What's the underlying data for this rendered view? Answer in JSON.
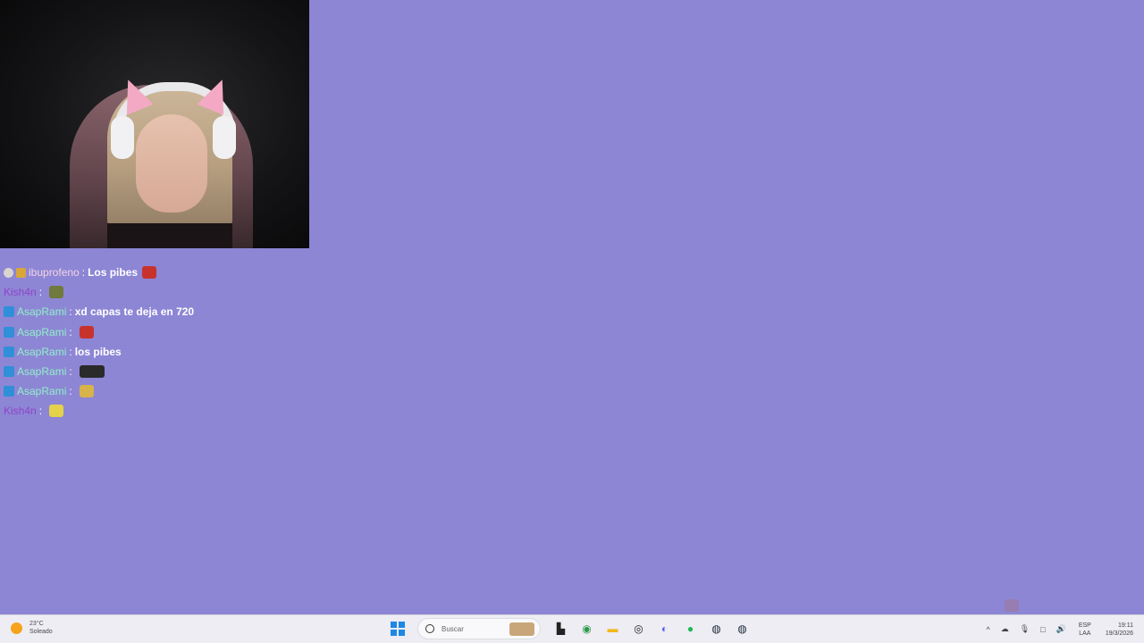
{
  "webcam": {
    "label": "webcam-feed"
  },
  "chat": {
    "messages": [
      {
        "badges": [
          "gray",
          "gold"
        ],
        "user": "ibuprofeno",
        "user_color": "#f3d3e3",
        "text": "Los pibes",
        "emote": "devil-emote",
        "emote_color": "#c8322c"
      },
      {
        "badges": [],
        "user": "Kish4n",
        "user_color": "#8e44c8",
        "text": "",
        "emote": "frog-emote",
        "emote_color": "#6f7a3c"
      },
      {
        "badges": [
          "blue"
        ],
        "user": "AsapRami",
        "user_color": "#8ff0c8",
        "text": "xd capas te deja en 720",
        "emote": "",
        "emote_color": ""
      },
      {
        "badges": [
          "blue"
        ],
        "user": "AsapRami",
        "user_color": "#8ff0c8",
        "text": "",
        "emote": "devil-emote",
        "emote_color": "#c8322c"
      },
      {
        "badges": [
          "blue"
        ],
        "user": "AsapRami",
        "user_color": "#8ff0c8",
        "text": "los pibes",
        "emote": "",
        "emote_color": ""
      },
      {
        "badges": [
          "blue"
        ],
        "user": "AsapRami",
        "user_color": "#8ff0c8",
        "text": "",
        "emote": "dark-emote",
        "emote_color": "#2a2a2a"
      },
      {
        "badges": [
          "blue"
        ],
        "user": "AsapRami",
        "user_color": "#8ff0c8",
        "text": "",
        "emote": "hand-emote",
        "emote_color": "#d8b24a"
      },
      {
        "badges": [],
        "user": "Kish4n",
        "user_color": "#8e44c8",
        "text": "",
        "emote": "sunglasses-emote",
        "emote_color": "#e3d24a"
      }
    ],
    "separator": ":"
  },
  "taskbar": {
    "weather_temp": "23°C",
    "weather_desc": "Soleado",
    "search_placeholder": "Buscar",
    "lang_line1": "ESP",
    "lang_line2": "LAA",
    "time": "19:11",
    "date": "19/3/2026",
    "apps": [
      {
        "name": "task-view-icon",
        "glyph": "▙",
        "color": "#222222"
      },
      {
        "name": "chrome-icon",
        "glyph": "◉",
        "color": "#2b9a48"
      },
      {
        "name": "file-explorer-icon",
        "glyph": "▬",
        "color": "#f2b81c"
      },
      {
        "name": "obs-icon",
        "glyph": "◎",
        "color": "#222222"
      },
      {
        "name": "discord-icon",
        "glyph": "◐",
        "color": "#5865f2"
      },
      {
        "name": "spotify-icon",
        "glyph": "●",
        "color": "#1db954"
      },
      {
        "name": "steam-icon",
        "glyph": "◍",
        "color": "#1b2838"
      },
      {
        "name": "steam-icon-2",
        "glyph": "◍",
        "color": "#1b2838"
      }
    ],
    "tray_icons": [
      "^",
      "☁",
      "🎙",
      "□",
      "🔊"
    ]
  },
  "colors": {
    "background": "#8d86d5"
  }
}
